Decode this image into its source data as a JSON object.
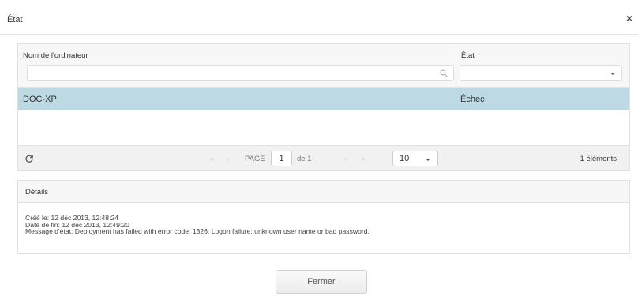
{
  "dialog": {
    "title": "État",
    "close_glyph": "×",
    "close_button_label": "Fermer"
  },
  "grid": {
    "columns": [
      "Nom de l'ordinateur",
      "État"
    ],
    "filters": {
      "name_value": "",
      "state_value": ""
    },
    "rows": [
      {
        "name": "DOC-XP",
        "state": "Échec",
        "selected": true
      }
    ],
    "pager": {
      "first_glyph": "«",
      "prev_glyph": "‹",
      "next_glyph": "›",
      "last_glyph": "»",
      "page_label": "PAGE",
      "page_value": "1",
      "of_label": "de 1",
      "page_size": "10",
      "item_count": "1 éléments"
    }
  },
  "details": {
    "title": "Détails",
    "lines": [
      "Créé le: 12 déc 2013, 12:48:24",
      "Date de fin: 12 déc 2013, 12:49:20",
      "Message d'état: Deployment has failed with error code: 1326: Logon failure: unknown user name or bad password."
    ]
  },
  "colors": {
    "selected_row": "#bcd9e4",
    "header_bg": "#f7f7f7",
    "pager_bg": "#f1f1f1",
    "border": "#e1e1e1"
  },
  "icons": {
    "search": "search-icon",
    "dropdown": "chevron-down-icon",
    "refresh": "refresh-icon",
    "close": "close-icon"
  }
}
